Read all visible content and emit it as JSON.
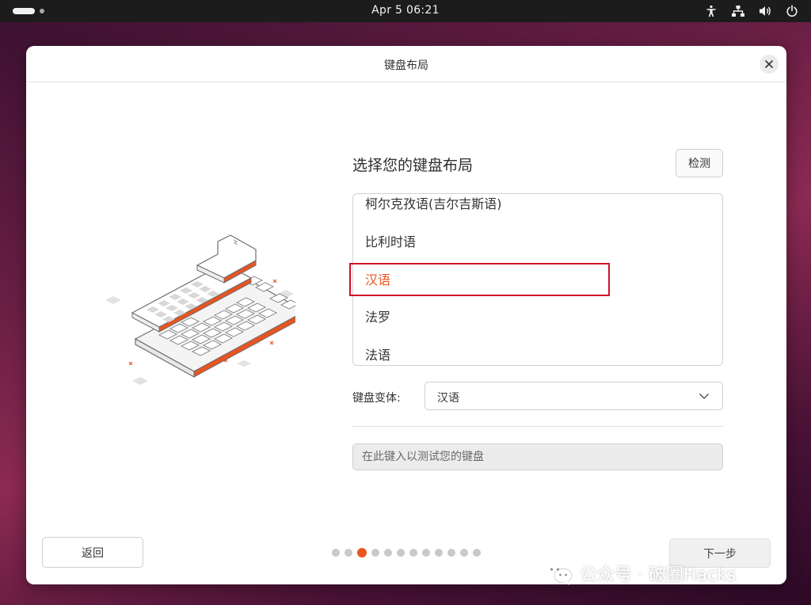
{
  "topbar": {
    "clock": "Apr 5  06:21",
    "icons": [
      "accessibility-icon",
      "network-icon",
      "volume-icon",
      "power-icon"
    ]
  },
  "dialog": {
    "title": "键盘布局",
    "heading": "选择您的键盘布局",
    "detect_label": "检测",
    "layouts": [
      {
        "label": "柯尔克孜语(吉尔吉斯语)",
        "selected": false
      },
      {
        "label": "比利时语",
        "selected": false
      },
      {
        "label": "汉语",
        "selected": true
      },
      {
        "label": "法罗",
        "selected": false
      },
      {
        "label": "法语",
        "selected": false
      }
    ],
    "variant_label": "键盘变体:",
    "variant_value": "汉语",
    "test_placeholder": "在此键入以测试您的键盘",
    "back_label": "返回",
    "next_label": "下一步",
    "progress": {
      "total": 12,
      "current": 3
    }
  },
  "colors": {
    "accent": "#e95420",
    "highlight_box": "#d0102a",
    "topbar": "#1c1c1c"
  },
  "watermark": {
    "text": "公众号 · 破圈Hacks",
    "icon": "wechat-icon"
  }
}
